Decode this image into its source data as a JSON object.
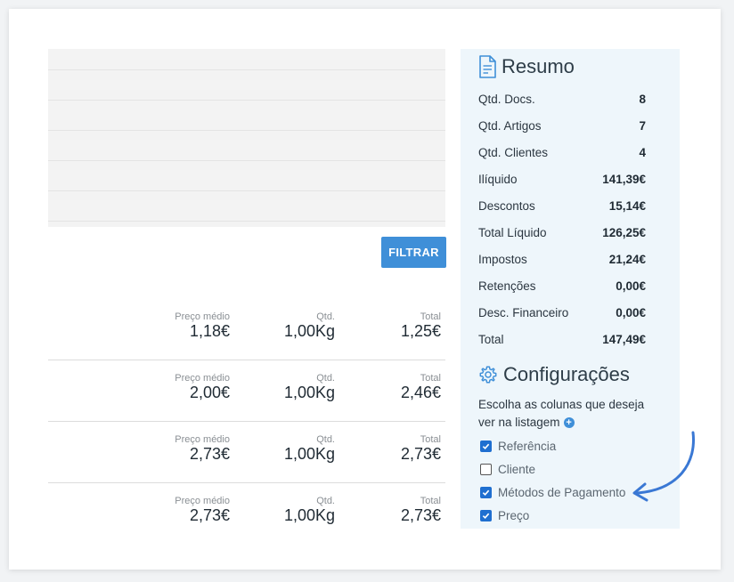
{
  "filter": {
    "button_label": "FILTRAR"
  },
  "products": [
    {
      "preco_label": "Preço médio",
      "preco": "1,18€",
      "qtd_label": "Qtd.",
      "qtd": "1,00Kg",
      "total_label": "Total",
      "total": "1,25€"
    },
    {
      "preco_label": "Preço médio",
      "preco": "2,00€",
      "qtd_label": "Qtd.",
      "qtd": "1,00Kg",
      "total_label": "Total",
      "total": "2,46€"
    },
    {
      "preco_label": "Preço médio",
      "preco": "2,73€",
      "qtd_label": "Qtd.",
      "qtd": "1,00Kg",
      "total_label": "Total",
      "total": "2,73€"
    },
    {
      "preco_label": "Preço médio",
      "preco": "2,73€",
      "qtd_label": "Qtd.",
      "qtd": "1,00Kg",
      "total_label": "Total",
      "total": "2,73€"
    }
  ],
  "summary": {
    "title": "Resumo",
    "rows": [
      {
        "label": "Qtd. Docs.",
        "value": "8"
      },
      {
        "label": "Qtd. Artigos",
        "value": "7"
      },
      {
        "label": "Qtd. Clientes",
        "value": "4"
      },
      {
        "label": "Ilíquido",
        "value": "141,39€"
      },
      {
        "label": "Descontos",
        "value": "15,14€"
      },
      {
        "label": "Total Líquido",
        "value": "126,25€"
      },
      {
        "label": "Impostos",
        "value": "21,24€"
      },
      {
        "label": "Retenções",
        "value": "0,00€"
      },
      {
        "label": "Desc. Financeiro",
        "value": "0,00€"
      },
      {
        "label": "Total",
        "value": "147,49€"
      }
    ]
  },
  "config": {
    "title": "Configurações",
    "description": "Escolha as colunas que deseja ver na listagem",
    "columns": [
      {
        "label": "Referência",
        "checked": true
      },
      {
        "label": "Cliente",
        "checked": false
      },
      {
        "label": "Métodos de Pagamento",
        "checked": true
      },
      {
        "label": "Preço",
        "checked": true
      }
    ]
  },
  "colors": {
    "accent": "#3f8fd8",
    "sidebar_bg": "#eef6fb",
    "checkbox": "#1f6fd0",
    "arrow": "#3a78d4"
  }
}
